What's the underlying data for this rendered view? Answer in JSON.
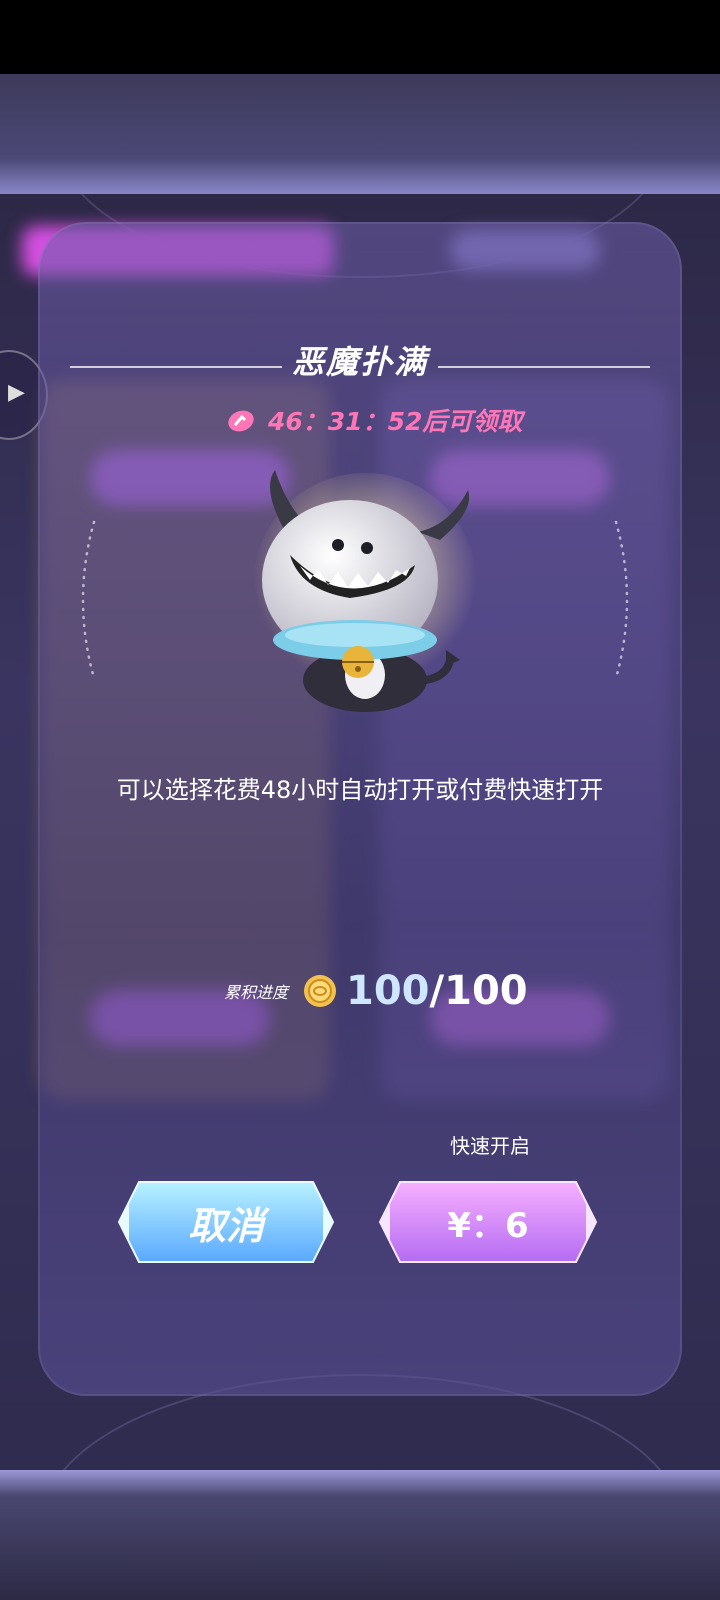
{
  "dialog": {
    "title": "恶魔扑满",
    "timer_text": "46：31：52后可领取",
    "description": "可以选择花费48小时自动打开或付费快速打开",
    "progress_label": "累积进度",
    "progress_current": "100",
    "progress_total": "/100",
    "fast_open_label": "快速开启",
    "cancel_label": "取消",
    "fast_price_label": "¥：6"
  },
  "icons": {
    "timer": "clock-icon",
    "coin": "coin-icon",
    "side": "play-arrow-icon",
    "mascot": "demon-piggybank-mascot"
  },
  "colors": {
    "timer": "#ff76b6",
    "cancel_button": "#7fd8ff",
    "fast_button": "#d986ff",
    "panel": "#5a4f96"
  }
}
